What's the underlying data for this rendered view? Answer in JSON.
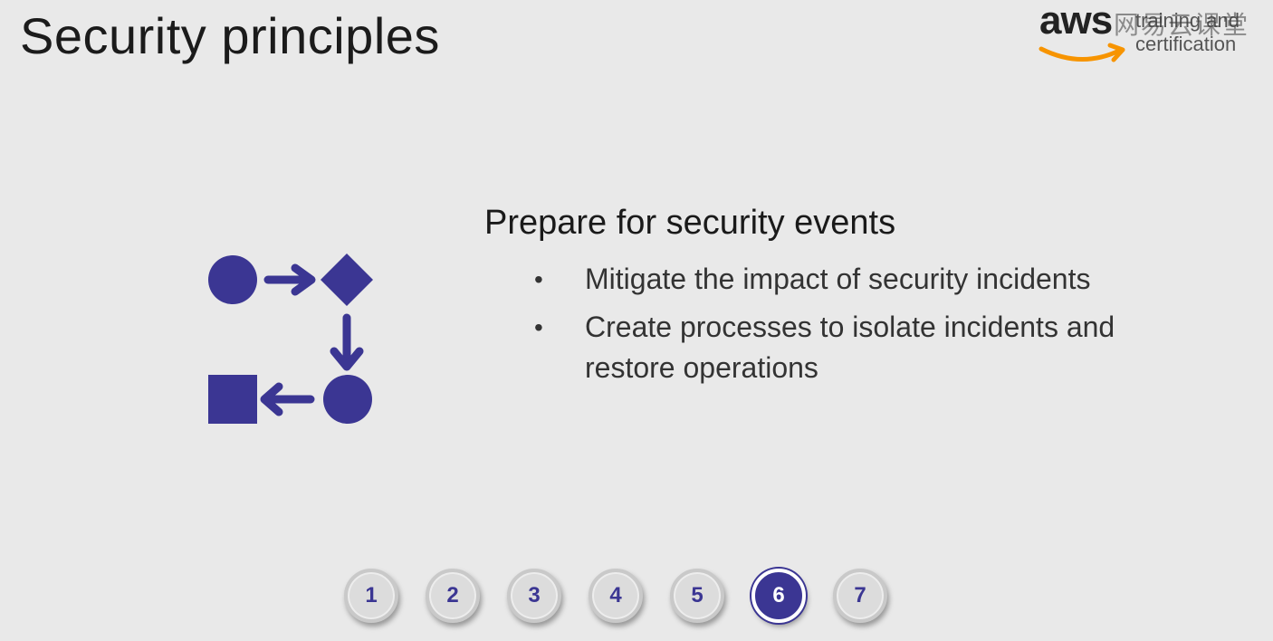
{
  "slide": {
    "title": "Security principles",
    "heading": "Prepare for security events",
    "bullets": [
      "Mitigate the impact of security incidents",
      "Create processes to isolate incidents and restore operations"
    ]
  },
  "logo": {
    "brand": "aws",
    "line1": "training and",
    "line2": "certification",
    "watermark": "网易云课堂"
  },
  "diagram": {
    "icon": "process-flow-icon",
    "color": "#3b3693"
  },
  "pager": {
    "active": 6,
    "pages": [
      "1",
      "2",
      "3",
      "4",
      "5",
      "6",
      "7"
    ]
  },
  "colors": {
    "accent": "#3b3693",
    "background": "#e9e9e9",
    "logo_smile": "#f79400"
  }
}
